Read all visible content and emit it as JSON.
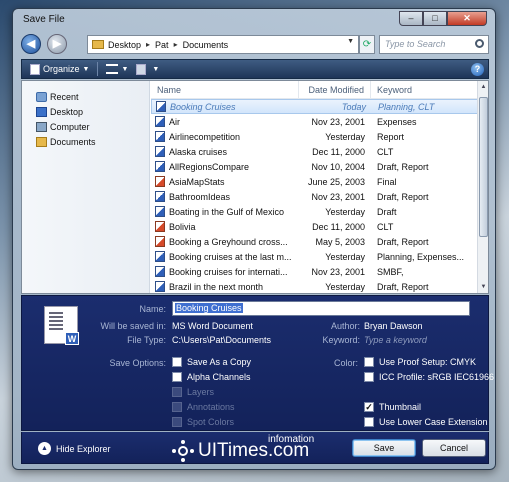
{
  "window": {
    "title": "Save File"
  },
  "nav": {
    "breadcrumb": [
      "Desktop",
      "Pat",
      "Documents"
    ],
    "search_placeholder": "Type to Search"
  },
  "toolbar": {
    "organize": "Organize"
  },
  "sidebar": {
    "items": [
      {
        "label": "Recent"
      },
      {
        "label": "Desktop"
      },
      {
        "label": "Computer"
      },
      {
        "label": "Documents"
      }
    ]
  },
  "filelist": {
    "columns": {
      "name": "Name",
      "date": "Date Modified",
      "keyword": "Keyword"
    },
    "rows": [
      {
        "name": "Booking Cruises",
        "date": "Today",
        "keyword": "Planning, CLT",
        "type": "word"
      },
      {
        "name": "Air",
        "date": "Nov 23, 2001",
        "keyword": "Expenses",
        "type": "word"
      },
      {
        "name": "Airlinecompetition",
        "date": "Yesterday",
        "keyword": "Report",
        "type": "word"
      },
      {
        "name": "Alaska cruises",
        "date": "Dec 11, 2000",
        "keyword": "CLT",
        "type": "word"
      },
      {
        "name": "AllRegionsCompare",
        "date": "Nov 10, 2004",
        "keyword": "Draft, Report",
        "type": "word"
      },
      {
        "name": "AsiaMapStats",
        "date": "June 25, 2003",
        "keyword": "Final",
        "type": "ppt"
      },
      {
        "name": "BathroomIdeas",
        "date": "Nov 23, 2001",
        "keyword": "Draft, Report",
        "type": "word"
      },
      {
        "name": "Boating in the Gulf of Mexico",
        "date": "Yesterday",
        "keyword": "Draft",
        "type": "word"
      },
      {
        "name": "Bolivia",
        "date": "Dec 11, 2000",
        "keyword": "CLT",
        "type": "ppt"
      },
      {
        "name": "Booking a Greyhound cross...",
        "date": "May 5, 2003",
        "keyword": "Draft, Report",
        "type": "ppt"
      },
      {
        "name": "Booking cruises at the last m...",
        "date": "Yesterday",
        "keyword": "Planning, Expenses...",
        "type": "word"
      },
      {
        "name": "Booking cruises for internati...",
        "date": "Nov 23, 2001",
        "keyword": "SMBF,",
        "type": "word"
      },
      {
        "name": "Brazil in the next month",
        "date": "Yesterday",
        "keyword": "Draft, Report",
        "type": "word"
      }
    ]
  },
  "details": {
    "name_label": "Name:",
    "name_value": "Booking Cruises",
    "saved_in_label": "Will be saved in:",
    "saved_in_value": "MS Word Document",
    "filetype_label": "File Type:",
    "filetype_value": "C:\\Users\\Pat\\Documents",
    "author_label": "Author:",
    "author_value": "Bryan Dawson",
    "keyword_label": "Keyword:",
    "keyword_placeholder": "Type a keyword",
    "save_options_label": "Save Options:",
    "color_label": "Color:",
    "options": {
      "save_as_copy": "Save As a Copy",
      "alpha_channels": "Alpha Channels",
      "layers": "Layers",
      "annotations": "Annotations",
      "spot_colors": "Spot Colors",
      "proof_setup": "Use Proof Setup: CMYK",
      "icc_profile": "ICC Profile: sRGB IEC61966",
      "thumbnail": "Thumbnail",
      "lower_case": "Use Lower Case Extension"
    },
    "checked": {
      "thumbnail": true
    }
  },
  "footer": {
    "hide_explorer": "Hide Explorer",
    "logo_main": "UITimes.com",
    "logo_sub": "infomation",
    "save": "Save",
    "cancel": "Cancel"
  }
}
